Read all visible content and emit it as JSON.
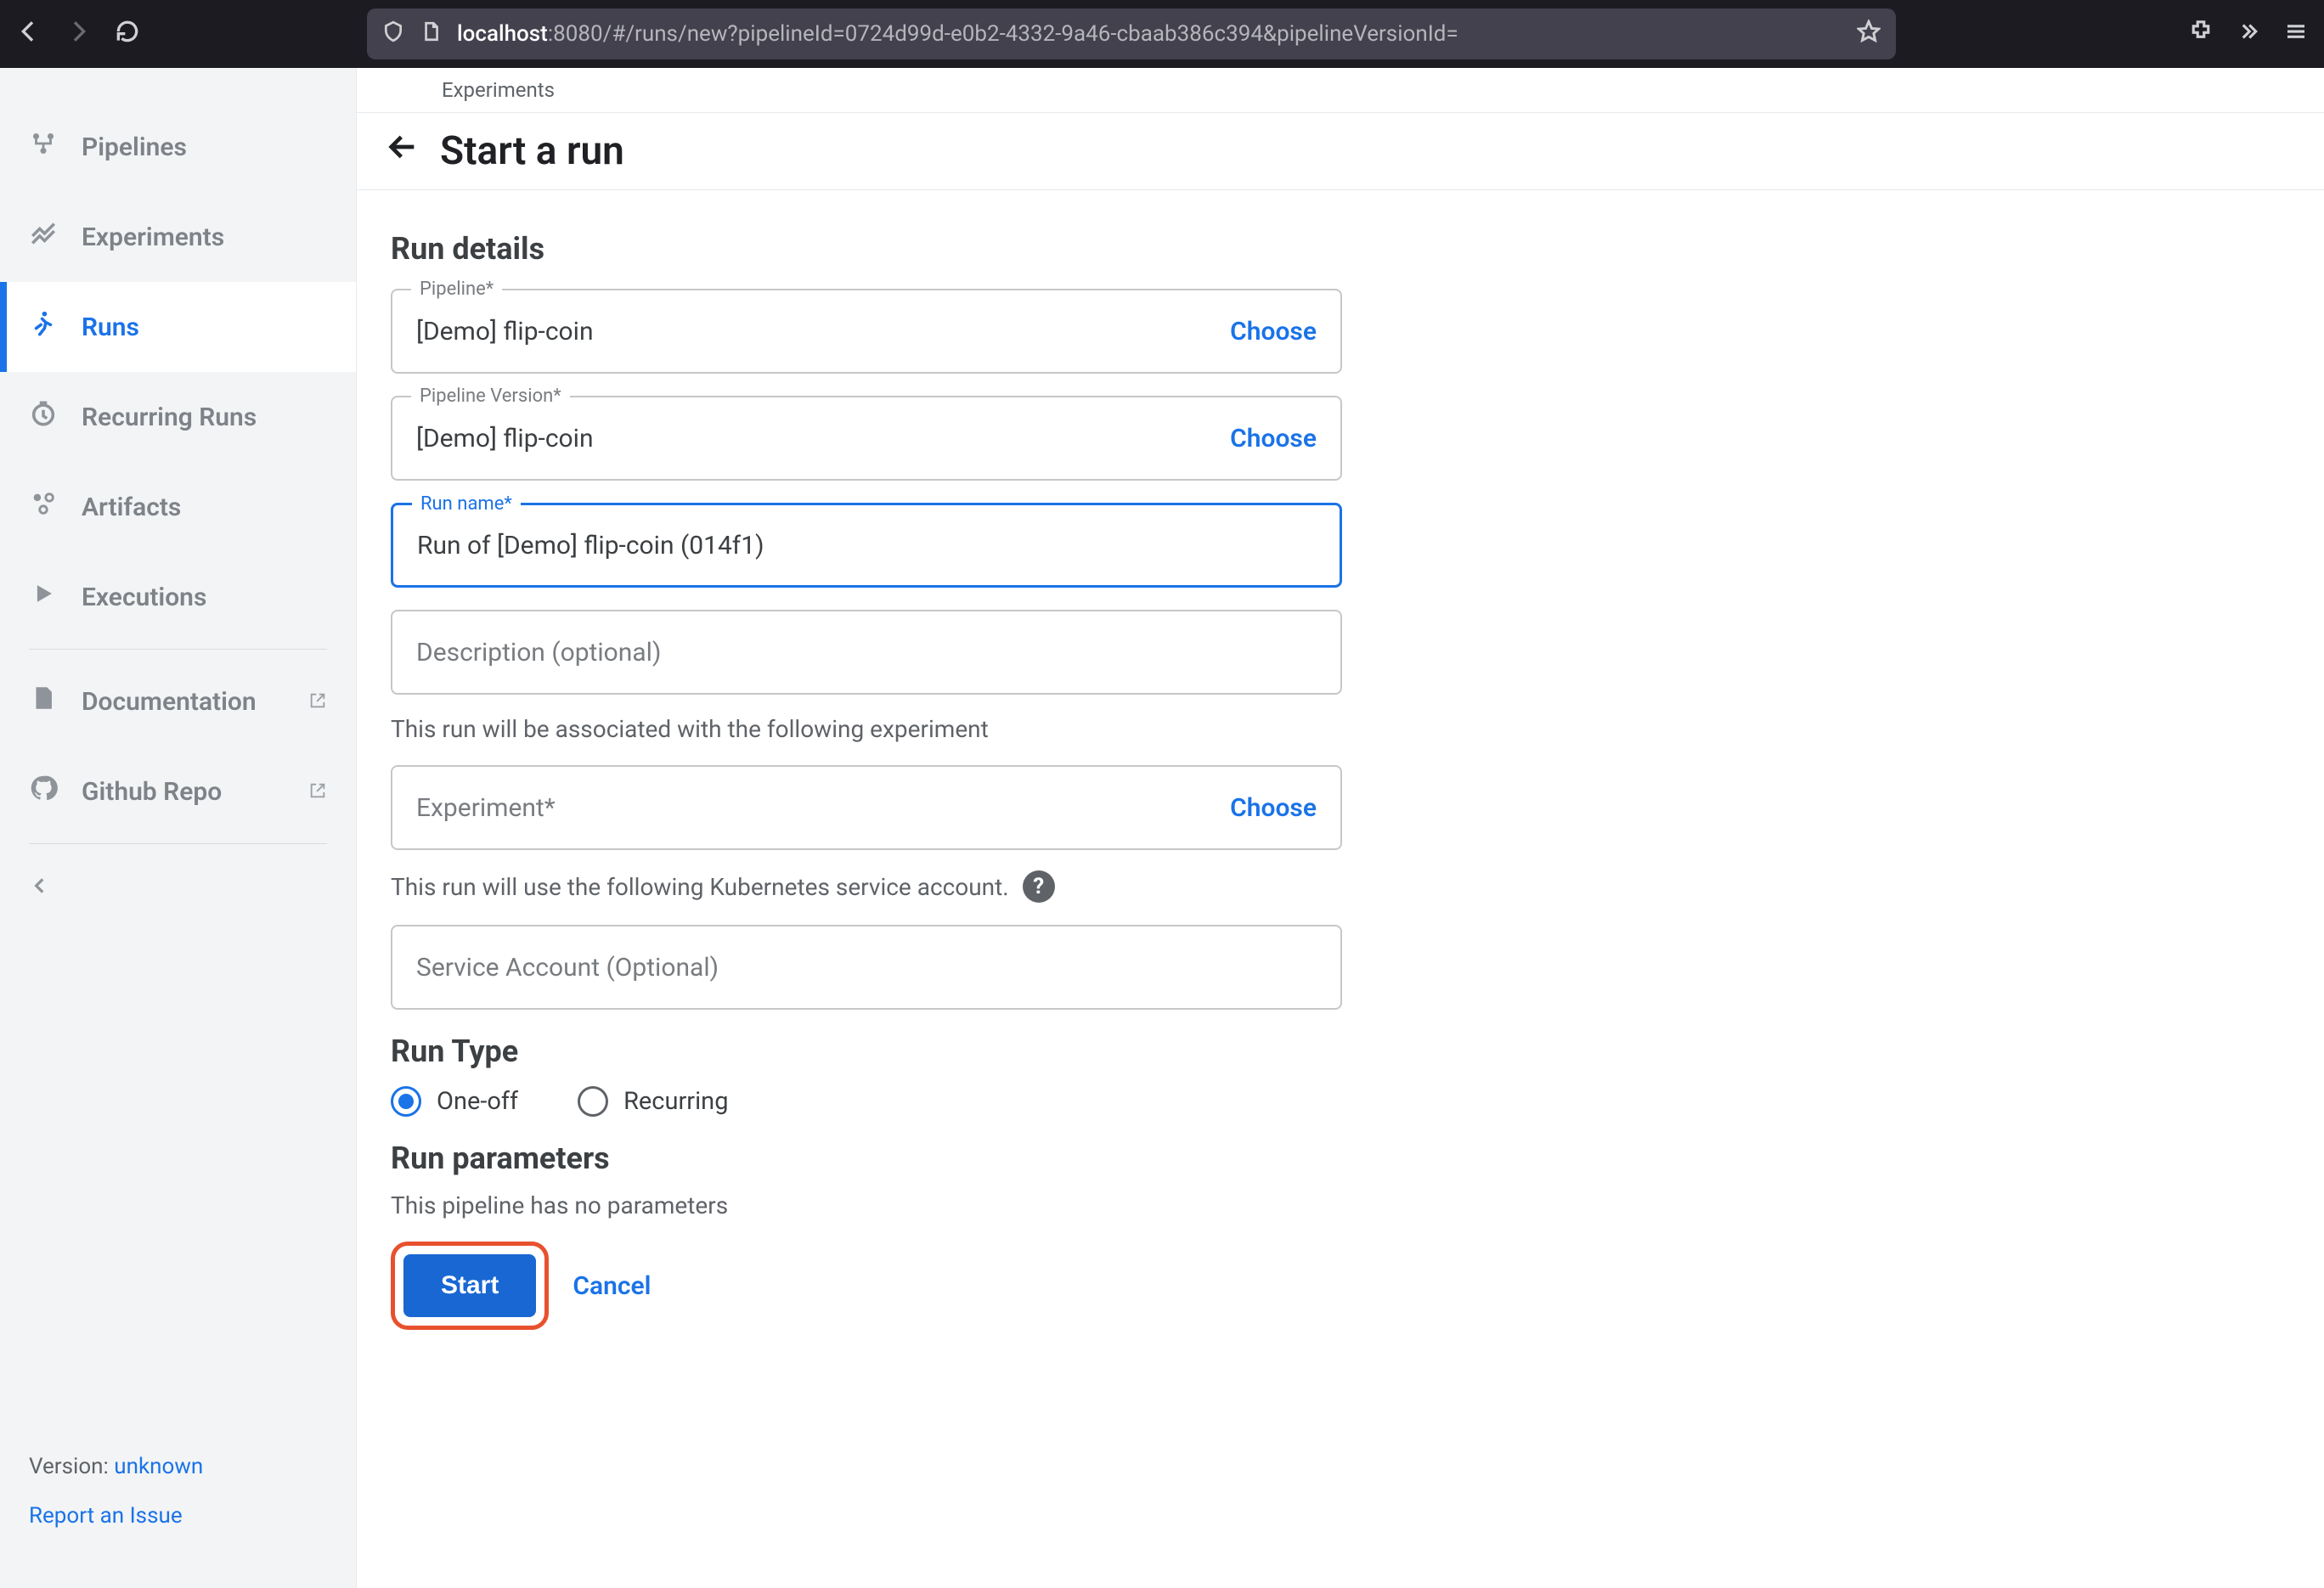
{
  "browser": {
    "host": "localhost",
    "rest": ":8080/#/runs/new?pipelineId=0724d99d-e0b2-4332-9a46-cbaab386c394&pipelineVersionId="
  },
  "sidebar": {
    "items": [
      {
        "label": "Pipelines"
      },
      {
        "label": "Experiments"
      },
      {
        "label": "Runs"
      },
      {
        "label": "Recurring Runs"
      },
      {
        "label": "Artifacts"
      },
      {
        "label": "Executions"
      },
      {
        "label": "Documentation"
      },
      {
        "label": "Github Repo"
      }
    ],
    "version_label": "Version: ",
    "version_value": "unknown",
    "report_issue": "Report an Issue"
  },
  "header": {
    "breadcrumb": "Experiments",
    "title": "Start a run"
  },
  "form": {
    "run_details_heading": "Run details",
    "pipeline_label": "Pipeline*",
    "pipeline_value": "[Demo] flip-coin",
    "choose": "Choose",
    "pipeline_version_label": "Pipeline Version*",
    "pipeline_version_value": "[Demo] flip-coin",
    "run_name_label": "Run name*",
    "run_name_value": "Run of [Demo] flip-coin (014f1)",
    "description_placeholder": "Description (optional)",
    "experiment_hint": "This run will be associated with the following experiment",
    "experiment_placeholder": "Experiment*",
    "service_account_hint": "This run will use the following Kubernetes service account.",
    "service_account_placeholder": "Service Account (Optional)",
    "run_type_heading": "Run Type",
    "radio_oneoff": "One-off",
    "radio_recurring": "Recurring",
    "run_params_heading": "Run parameters",
    "no_params": "This pipeline has no parameters",
    "start": "Start",
    "cancel": "Cancel"
  }
}
